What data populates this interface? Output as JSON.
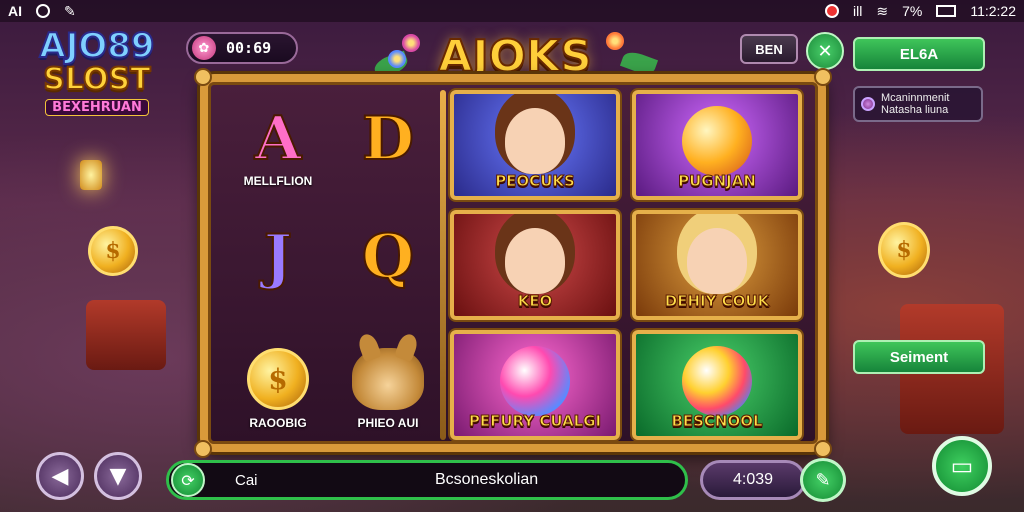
{
  "status_bar": {
    "left_label": "AI",
    "time": "11:2:22",
    "battery": "7%",
    "signal": "ill"
  },
  "logo": {
    "line1": "AJO89",
    "line2": "SLOST",
    "line3": "BEXEHRUAN"
  },
  "timer": {
    "value": "00:69",
    "icon": "flower-icon"
  },
  "title": "AJOKS",
  "top_right": {
    "bn_label": "BEN",
    "tools_icon": "tools-icon",
    "primary_label": "EL6A",
    "notice_text": "Mcaninnmenit Natasha liuna"
  },
  "reels": {
    "left_symbols": [
      {
        "glyph": "A",
        "label": "MELLFLION",
        "color": "#ff6fc7"
      },
      {
        "glyph": "D",
        "label": "",
        "color": "#ffb020"
      },
      {
        "glyph": "J",
        "label": "",
        "color": "#9a7aff"
      },
      {
        "glyph": "Q",
        "label": "",
        "color": "#ffb020"
      },
      {
        "glyph": "$",
        "label": "RAOOBIG",
        "color": "#ffd030"
      },
      {
        "glyph": "",
        "label": "PHIEO AUI",
        "color": "#c48a3a"
      }
    ],
    "tiles": [
      {
        "label": "PEOCUKS",
        "bg": "#3a3ab0"
      },
      {
        "label": "PUGNJAN",
        "bg": "#7a2aa0"
      },
      {
        "label": "KEO",
        "bg": "#a02a2a"
      },
      {
        "label": "DEHIY COUK",
        "bg": "#b06a1a"
      },
      {
        "label": "PEFURY CUALGI",
        "bg": "#c03ab0"
      },
      {
        "label": "BESCNOOL",
        "bg": "#1a9a3a"
      }
    ]
  },
  "side": {
    "secondary_label": "Seiment",
    "coin_glyph": "$"
  },
  "bottom": {
    "back_icon": "back-arrow-icon",
    "bet_icon": "bet-cup-icon",
    "bar_icon": "refresh-icon",
    "bar_left": "Cai",
    "bar_center": "Bcsoneskolian",
    "credit": "4:039",
    "credit_icon": "tag-icon",
    "chat_icon": "chat-icon"
  }
}
